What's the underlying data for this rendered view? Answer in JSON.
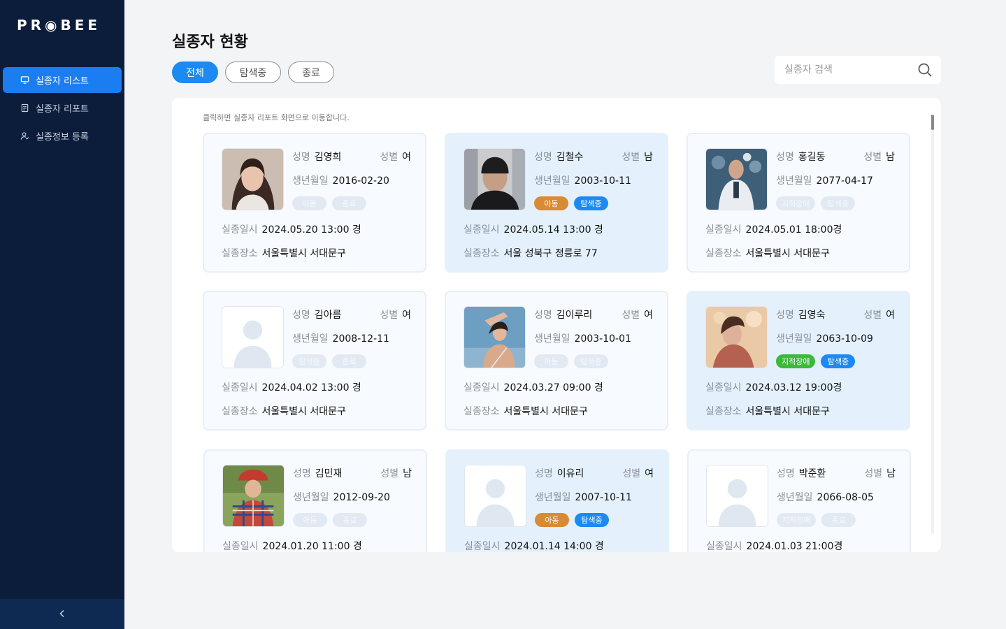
{
  "app": {
    "logo": "PR◉BEE",
    "colors": {
      "sidebar": "#0b1d3a",
      "accent": "#1c7df0",
      "child_tag": "#d98a34",
      "searching_tag": "#1c8af2",
      "disability_tag": "#3cb83a"
    }
  },
  "sidebar": {
    "items": [
      {
        "label": "실종자 리스트",
        "icon": "monitor-icon"
      },
      {
        "label": "실종자 리포트",
        "icon": "document-icon"
      },
      {
        "label": "실종정보 등록",
        "icon": "person-register-icon"
      }
    ],
    "collapse_icon": "chevron-left-icon"
  },
  "header": {
    "title": "실종자 현황",
    "filters": [
      "전체",
      "탐색중",
      "종료"
    ],
    "active_filter": "전체",
    "search_placeholder": "실종자 검색"
  },
  "list": {
    "hint": "클릭하면 실종자 리포트 화면으로 이동합니다.",
    "labels": {
      "name": "성명",
      "gender": "성별",
      "birth": "생년월일",
      "date": "실종일시",
      "place": "실종장소"
    },
    "cards": [
      {
        "name": "김영희",
        "gender": "여",
        "birth": "2016-02-20",
        "date": "2024.05.20 13:00 경",
        "place": "서울특별시 서대문구",
        "tags": [
          "아동",
          "종료"
        ],
        "tags_active": false,
        "photo": "girl-photo"
      },
      {
        "name": "김철수",
        "gender": "남",
        "birth": "2003-10-11",
        "date": "2024.05.14 13:00 경",
        "place": "서울 성북구 정릉로 77",
        "tags": [
          "아동",
          "탐색중"
        ],
        "tags_active": true,
        "photo": "man-beanie-photo"
      },
      {
        "name": "홍길동",
        "gender": "남",
        "birth": "2077-04-17",
        "date": "2024.05.01 18:00경",
        "place": "서울특별시 서대문구",
        "tags": [
          "지적장애",
          "탐색중"
        ],
        "tags_active": false,
        "photo": "elderly-man-photo"
      },
      {
        "name": "김아름",
        "gender": "여",
        "birth": "2008-12-11",
        "date": "2024.04.02 13:00 경",
        "place": "서울특별시 서대문구",
        "tags": [
          "탐색중",
          "종료"
        ],
        "tags_active": false,
        "photo": "placeholder-avatar"
      },
      {
        "name": "김이루리",
        "gender": "여",
        "birth": "2003-10-01",
        "date": "2024.03.27 09:00 경",
        "place": "서울특별시 서대문구",
        "tags": [
          "아동",
          "탐색중"
        ],
        "tags_active": false,
        "photo": "woman-sky-photo"
      },
      {
        "name": "김영숙",
        "gender": "여",
        "birth": "2063-10-09",
        "date": "2024.03.12 19:00경",
        "place": "서울특별시 서대문구",
        "tags": [
          "지적장애",
          "탐색중"
        ],
        "tags_active": true,
        "photo": "woman-cafe-photo"
      },
      {
        "name": "김민재",
        "gender": "남",
        "birth": "2012-09-20",
        "date": "2024.01.20 11:00 경",
        "place": "",
        "tags": [
          "아동",
          "종료"
        ],
        "tags_active": false,
        "photo": "child-plaid-photo"
      },
      {
        "name": "이유리",
        "gender": "여",
        "birth": "2007-10-11",
        "date": "2024.01.14 14:00 경",
        "place": "",
        "tags": [
          "아동",
          "탐색중"
        ],
        "tags_active": true,
        "photo": "placeholder-avatar"
      },
      {
        "name": "박준환",
        "gender": "남",
        "birth": "2066-08-05",
        "date": "2024.01.03 21:00경",
        "place": "",
        "tags": [
          "지적장애",
          "종료"
        ],
        "tags_active": false,
        "photo": "placeholder-avatar"
      }
    ]
  }
}
